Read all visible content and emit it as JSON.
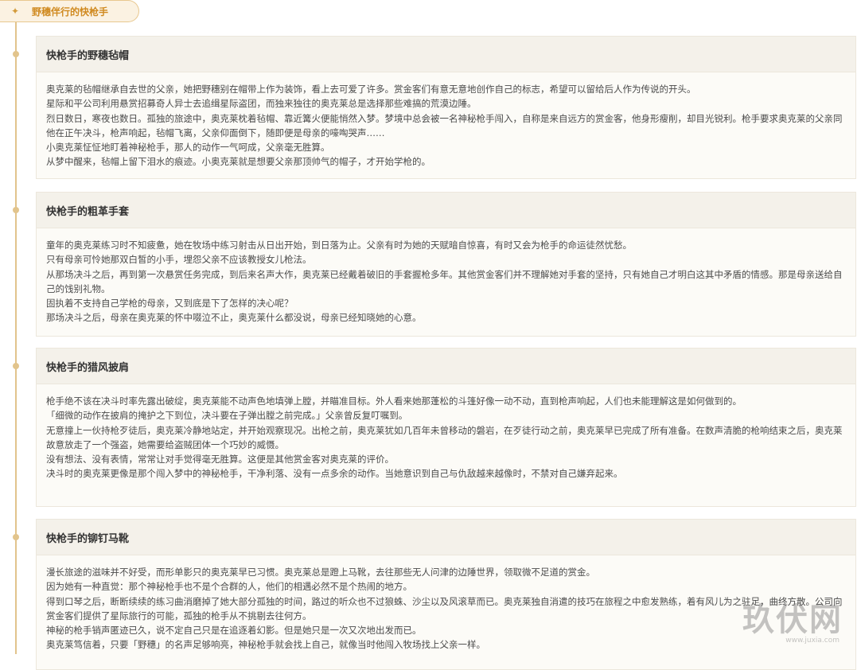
{
  "set": {
    "title": "野穗伴行的快枪手",
    "icon": "star-icon",
    "icon_glyph": "✦",
    "accent_color": "#d08a20"
  },
  "cards": [
    {
      "title": "快枪手的野穗毡帽",
      "paragraphs": [
        "奥克莱的毡帽继承自去世的父亲，她把野穗别在帽带上作为装饰，看上去可爱了许多。赏金客们有意无意地创作自己的标志，希望可以留给后人作为传说的开头。",
        "星际和平公司利用悬赏招募奇人异士去追缉星际盗团，而独来独往的奥克莱总是选择那些难搞的荒漠边陲。",
        "烈日数日，寒夜也数日。孤独的旅途中，奥克莱枕着毡帽、靠近篝火便能悄然入梦。梦境中总会被一名神秘枪手闯入，自称是来自远方的赏金客，他身形瘦削，却目光锐利。枪手要求奥克莱的父亲同他在正午决斗，枪声响起，毡帽飞离，父亲仰面倒下，随即便是母亲的嚎啕哭声……",
        "小奥克莱怔怔地盯着神秘枪手，那人的动作一气呵成，父亲毫无胜算。",
        "从梦中醒来，毡帽上留下泪水的痕迹。小奥克莱就是想要父亲那顶帅气的帽子，才开始学枪的。"
      ]
    },
    {
      "title": "快枪手的粗革手套",
      "paragraphs": [
        "童年的奥克莱练习时不知疲惫，她在牧场中练习射击从日出开始，到日落为止。父亲有时为她的天赋暗自惊喜，有时又会为枪手的命运徒然忧愁。",
        "只有母亲可怜她那双白皙的小手，埋怨父亲不应该教授女儿枪法。",
        "从那场决斗之后，再到第一次悬赏任务完成，到后来名声大作，奥克莱已经戴着破旧的手套握枪多年。其他赏金客们并不理解她对手套的坚持，只有她自己才明白这其中矛盾的情感。那是母亲送给自己的饯别礼物。",
        "固执着不支持自己学枪的母亲，又到底是下了怎样的决心呢？",
        "那场决斗之后，母亲在奥克莱的怀中啜泣不止，奥克莱什么都没说，母亲已经知晓她的心意。"
      ]
    },
    {
      "title": "快枪手的猎风披肩",
      "paragraphs": [
        "枪手绝不该在决斗时率先露出破绽，奥克莱能不动声色地填弹上膛，并瞄准目标。外人看来她那蓬松的斗篷好像一动不动，直到枪声响起，人们也未能理解这是如何做到的。",
        "「细微的动作在披肩的掩护之下到位，决斗要在子弹出膛之前完成。」父亲曾反复叮嘱到。",
        "无意撞上一伙持枪歹徒后，奥克莱冷静地站定，并开始观察现况。出枪之前，奥克莱犹如几百年未曾移动的磐岩，在歹徒行动之前，奥克莱早已完成了所有准备。在数声清脆的枪响结束之后，奥克莱故意放走了一个强盗，她需要给盗贼团体一个巧妙的威慑。",
        "没有想法、没有表情，常常让对手觉得毫无胜算。这便是其他赏金客对奥克莱的评价。",
        "决斗时的奥克莱更像是那个闯入梦中的神秘枪手，干净利落、没有一点多余的动作。当她意识到自己与仇敌越来越像时，不禁对自己嫌弃起来。"
      ]
    },
    {
      "title": "快枪手的铆钉马靴",
      "paragraphs": [
        "漫长旅途的滋味并不好受，而形单影只的奥克莱早已习惯。奥克莱总是蹬上马靴，去往那些无人问津的边陲世界，领取微不足道的赏金。",
        "因为她有一种直觉：那个神秘枪手也不是个合群的人，他们的相遇必然不是个热闹的地方。",
        "得到口琴之后，断断续续的练习曲消磨掉了她大部分孤独的时间，路过的听众也不过狼蛛、沙尘以及风滚草而已。奥克莱独自消遣的技巧在旅程之中愈发熟练，着有风儿为之驻足，曲终方散。公司向赏金客们提供了星际旅行的可能，孤独的枪手从不挑剔去往何方。",
        "神秘的枪手销声匿迹已久，说不定自己只是在追逐着幻影。但是她只是一次又次地出发而已。",
        "奥克莱笃信着，只要「野穗」的名声足够响亮，神秘枪手就会找上自己，就像当时他闯入牧场找上父亲一样。"
      ]
    }
  ],
  "watermark": {
    "text": "玖伏网",
    "subtext": "www.juxia.com"
  }
}
